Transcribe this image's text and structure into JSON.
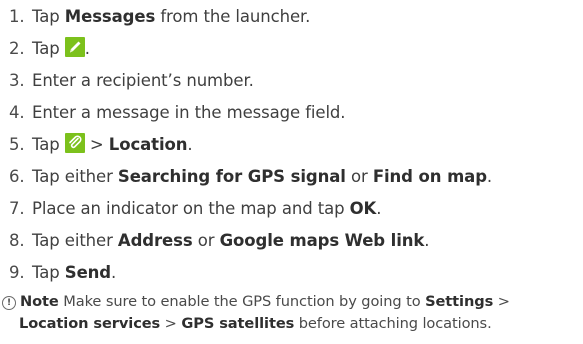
{
  "steps": [
    {
      "num": "1.",
      "a": "Tap ",
      "b": "Messages",
      "c": " from the launcher."
    },
    {
      "num": "2.",
      "a": "Tap ",
      "icon": "pencil-icon",
      "c": "."
    },
    {
      "num": "3.",
      "a": "Enter a recipient’s number."
    },
    {
      "num": "4.",
      "a": "Enter a message in the message field."
    },
    {
      "num": "5.",
      "a": "Tap ",
      "icon": "paperclip-icon",
      "c": " > ",
      "d": "Location",
      "e": "."
    },
    {
      "num": "6.",
      "a": "Tap either ",
      "b": "Searching for GPS signal",
      "c": " or ",
      "d": "Find on map",
      "e": "."
    },
    {
      "num": "7.",
      "a": "Place an indicator on the map and tap ",
      "b": "OK",
      "c": "."
    },
    {
      "num": "8.",
      "a": "Tap either ",
      "b": "Address",
      "c": " or ",
      "d": "Google maps Web link",
      "e": "."
    },
    {
      "num": "9.",
      "a": "Tap ",
      "b": "Send",
      "c": "."
    }
  ],
  "note": {
    "icon": "info-circle-icon",
    "glyph": "!",
    "label": "Note",
    "t1": " Make sure to enable the GPS function by going to ",
    "b1": "Settings",
    "t2": " >",
    "b2": "Location services",
    "t3": " > ",
    "b3": "GPS satellites",
    "t4": " before attaching locations."
  },
  "colors": {
    "icon_green": "#7cc11c",
    "text": "#3f3f3f"
  }
}
